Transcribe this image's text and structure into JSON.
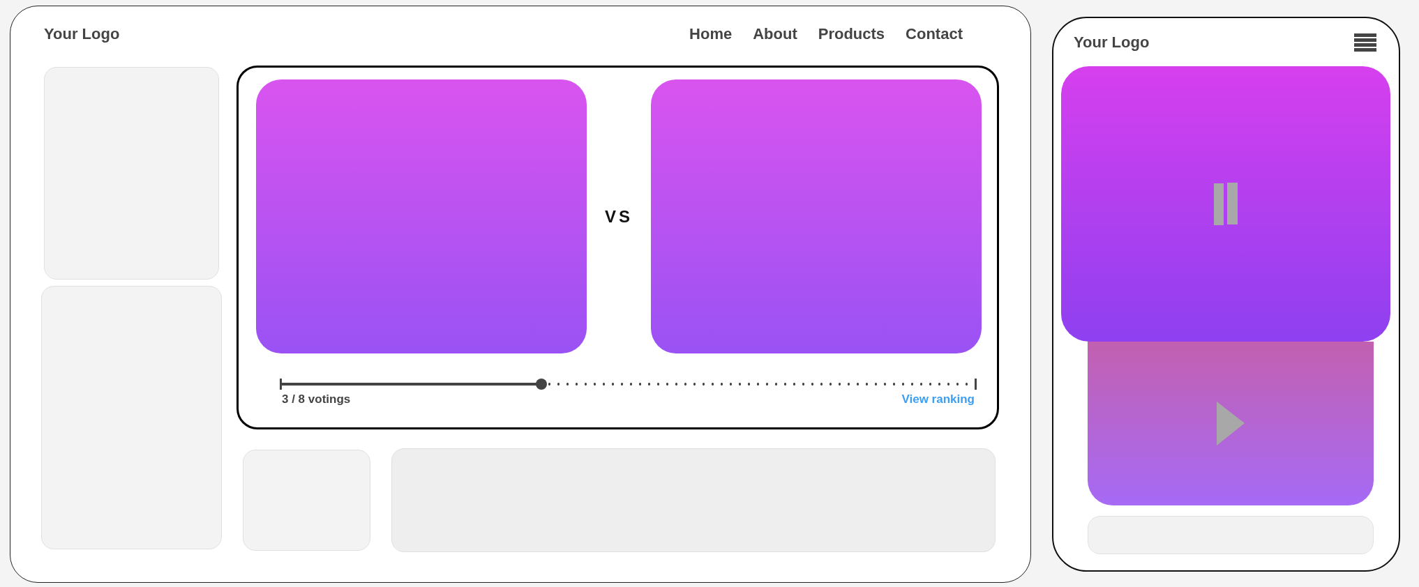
{
  "desktop": {
    "logo": "Your Logo",
    "nav": [
      {
        "label": "Home"
      },
      {
        "label": "About"
      },
      {
        "label": "Products"
      },
      {
        "label": "Contact"
      }
    ]
  },
  "voting": {
    "vs": "VS",
    "progress": {
      "level": 0.375,
      "label": "3 / 8 votings"
    },
    "link": "View ranking"
  },
  "mobile": {
    "logo": "Your Logo"
  }
}
